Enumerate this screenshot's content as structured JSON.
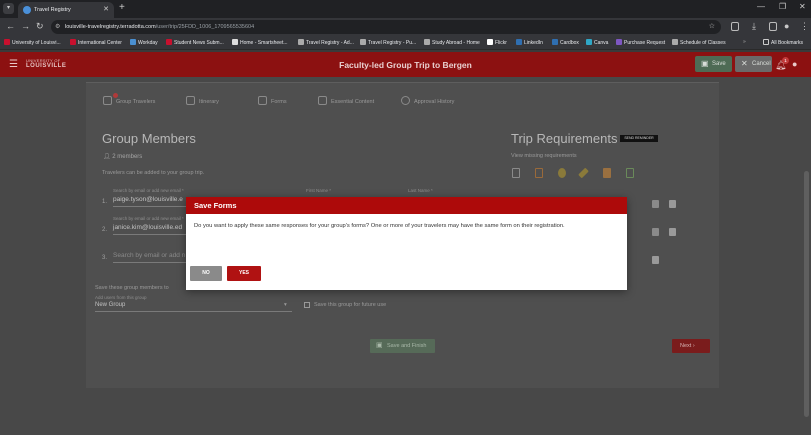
{
  "browser": {
    "tab_title": "Travel Registry",
    "tab_close": "✕",
    "new_tab": "+",
    "url_host": "louisville-travelregistry.terradotta.com",
    "url_path": "/user/trip/25FDD_1006_1709565535604",
    "bookmarks": [
      {
        "label": "University of Louisvi...",
        "color": "#c8102e"
      },
      {
        "label": "International Center",
        "color": "#c8102e"
      },
      {
        "label": "Workday",
        "color": "#4a8fd1"
      },
      {
        "label": "Student News Subm...",
        "color": "#c8102e"
      },
      {
        "label": "Home - Smartsheet...",
        "color": "#dddddd"
      },
      {
        "label": "Travel Registry - Ad...",
        "color": "#aaaaaa"
      },
      {
        "label": "Travel Registry - Pu...",
        "color": "#aaaaaa"
      },
      {
        "label": "Study Abroad - Home",
        "color": "#aaaaaa"
      },
      {
        "label": "Flickr",
        "color": "#ffffff"
      },
      {
        "label": "LinkedIn",
        "color": "#2f6fb1"
      },
      {
        "label": "Cardbox",
        "color": "#2f6fb1"
      },
      {
        "label": "Canva",
        "color": "#2fa7c6"
      },
      {
        "label": "Purchase Request",
        "color": "#7e57c2"
      },
      {
        "label": "Schedule of Classes",
        "color": "#aaaaaa"
      }
    ],
    "all_bookmarks": "All Bookmarks"
  },
  "app": {
    "logo_line1": "UNIVERSITY OF",
    "logo_line2": "LOUISVILLE",
    "title": "Faculty-led Group Trip to Bergen",
    "save_label": "Save",
    "cancel_label": "Cancel",
    "notification_count": "1"
  },
  "steps": [
    "Group Travelers",
    "Itinerary",
    "Forms",
    "Essential Content",
    "Approval History"
  ],
  "group": {
    "title": "Group Members",
    "member_count": "2 members",
    "hint": "Travelers can be added to your group trip.",
    "search_label": "Search by email or add new email *",
    "first_name_label": "First Name *",
    "last_name_label": "Last Name *",
    "rows": [
      {
        "num": "1.",
        "email": "paige.tyson@louisville.e"
      },
      {
        "num": "2.",
        "email": "janice.kim@louisville.ed"
      },
      {
        "num": "3.",
        "email": ""
      }
    ],
    "search_placeholder": "Search by email or add n",
    "save_as_label": "Save these group members to",
    "add_users_label": "Add users from this group",
    "group_select_value": "New Group",
    "save_future_label": "Save this group for future use"
  },
  "requirements": {
    "title": "Trip Requirements",
    "send_reminder": "SEND REMINDER",
    "view_missing": "View missing requirements"
  },
  "actions": {
    "save_finish": "Save and Finish",
    "next": "Next"
  },
  "modal": {
    "title": "Save Forms",
    "body": "Do you want to apply these same responses for your group's forms? One or more of your travelers may have the same form on their registration.",
    "no": "NO",
    "yes": "YES"
  }
}
